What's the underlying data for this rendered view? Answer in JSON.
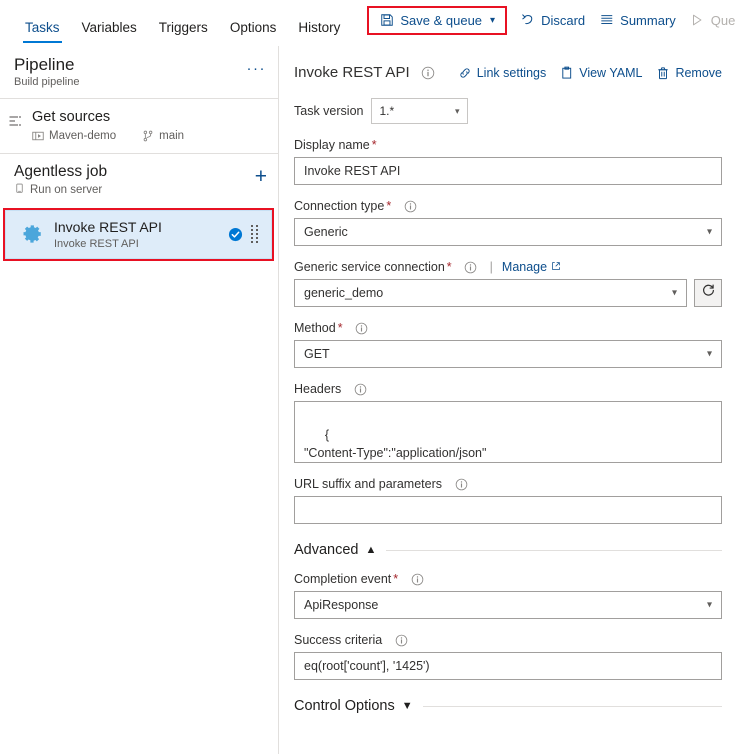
{
  "topbar": {
    "tabs": [
      {
        "label": "Tasks",
        "active": true
      },
      {
        "label": "Variables",
        "active": false
      },
      {
        "label": "Triggers",
        "active": false
      },
      {
        "label": "Options",
        "active": false
      },
      {
        "label": "History",
        "active": false
      }
    ],
    "commands": {
      "save_queue": "Save & queue",
      "discard": "Discard",
      "summary": "Summary",
      "queue": "Queue",
      "overflow": "···"
    },
    "highlight_color": "#e81123",
    "accent_color": "#0078d4",
    "link_color": "#0d4e8c"
  },
  "sidebar": {
    "pipeline": {
      "title": "Pipeline",
      "subtitle": "Build pipeline",
      "menu": "···"
    },
    "get_sources": {
      "title": "Get sources",
      "repository": "Maven-demo",
      "branch": "main"
    },
    "job": {
      "title": "Agentless job",
      "subtitle": "Run on server",
      "add": "+"
    },
    "task": {
      "title": "Invoke REST API",
      "subtitle": "Invoke REST API",
      "selected": true,
      "enabled_check": true,
      "highlight_color": "#e81123",
      "selected_bg": "#deecf9"
    }
  },
  "detail": {
    "title": "Invoke REST API",
    "actions": [
      {
        "label": "Link settings",
        "icon": "link-icon"
      },
      {
        "label": "View YAML",
        "icon": "yaml-icon"
      },
      {
        "label": "Remove",
        "icon": "trash-icon"
      }
    ],
    "task_version": {
      "label": "Task version",
      "value": "1.*"
    },
    "fields": {
      "display_name": {
        "label": "Display name",
        "required": true,
        "value": "Invoke REST API"
      },
      "connection_type": {
        "label": "Connection type",
        "required": true,
        "value": "Generic"
      },
      "service_connection": {
        "label": "Generic service connection",
        "required": true,
        "manage_link": "Manage",
        "value": "generic_demo"
      },
      "method": {
        "label": "Method",
        "required": true,
        "value": "GET"
      },
      "headers": {
        "label": "Headers",
        "required": false,
        "value": "{\n\"Content-Type\":\"application/json\"\n}"
      },
      "url_suffix": {
        "label": "URL suffix and parameters",
        "required": false,
        "value": ""
      },
      "completion_event": {
        "label": "Completion event",
        "required": true,
        "value": "ApiResponse"
      },
      "success_criteria": {
        "label": "Success criteria",
        "required": false,
        "value": "eq(root['count'], '1425')"
      }
    },
    "sections": {
      "advanced": {
        "label": "Advanced",
        "expanded": true,
        "chevron": "⌃"
      },
      "control_options": {
        "label": "Control Options",
        "expanded": false,
        "chevron": "⌄"
      }
    }
  }
}
